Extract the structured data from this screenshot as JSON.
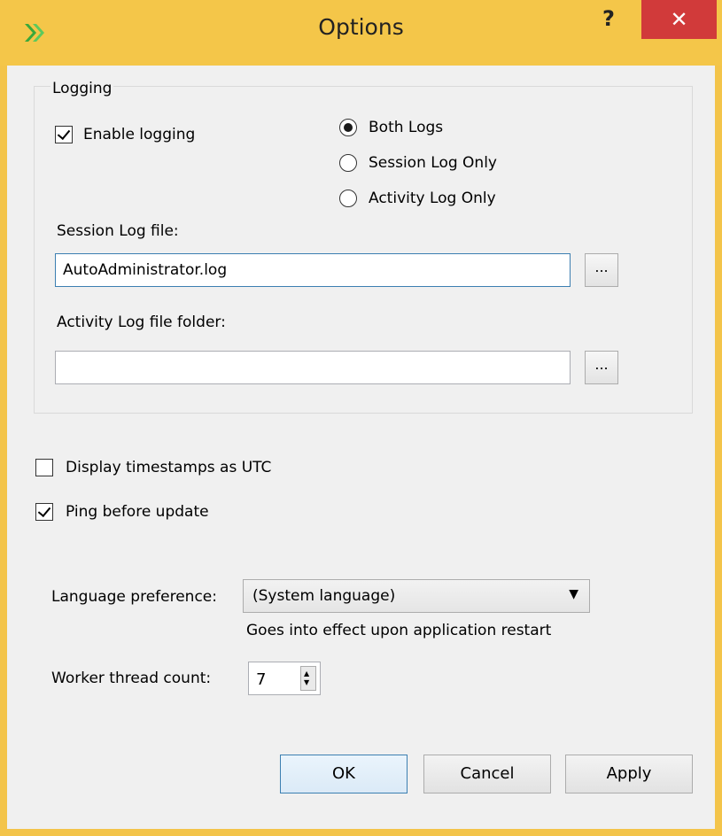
{
  "window": {
    "title": "Options",
    "help_label": "?",
    "close_label": "✕",
    "app_icon": "autoadministrator-logo-icon",
    "accent_color": "#f4c649",
    "close_color": "#d13a3a"
  },
  "logging": {
    "group_label": "Logging",
    "enable_logging": {
      "label": "Enable logging",
      "checked": true
    },
    "log_mode": {
      "options": [
        {
          "label": "Both Logs",
          "selected": true
        },
        {
          "label": "Session Log Only",
          "selected": false
        },
        {
          "label": "Activity Log Only",
          "selected": false
        }
      ]
    },
    "session_log": {
      "label": "Session Log file:",
      "value": "AutoAdministrator.log",
      "browse_label": "..."
    },
    "activity_log": {
      "label": "Activity Log file folder:",
      "value": "",
      "browse_label": "..."
    }
  },
  "options": {
    "utc": {
      "label": "Display timestamps as UTC",
      "checked": false
    },
    "ping": {
      "label": "Ping before update",
      "checked": true
    }
  },
  "language": {
    "label": "Language preference:",
    "selected": "(System language)",
    "note": "Goes into effect upon application restart"
  },
  "worker": {
    "label": "Worker thread count:",
    "value": "7"
  },
  "buttons": {
    "ok": "OK",
    "cancel": "Cancel",
    "apply": "Apply"
  }
}
